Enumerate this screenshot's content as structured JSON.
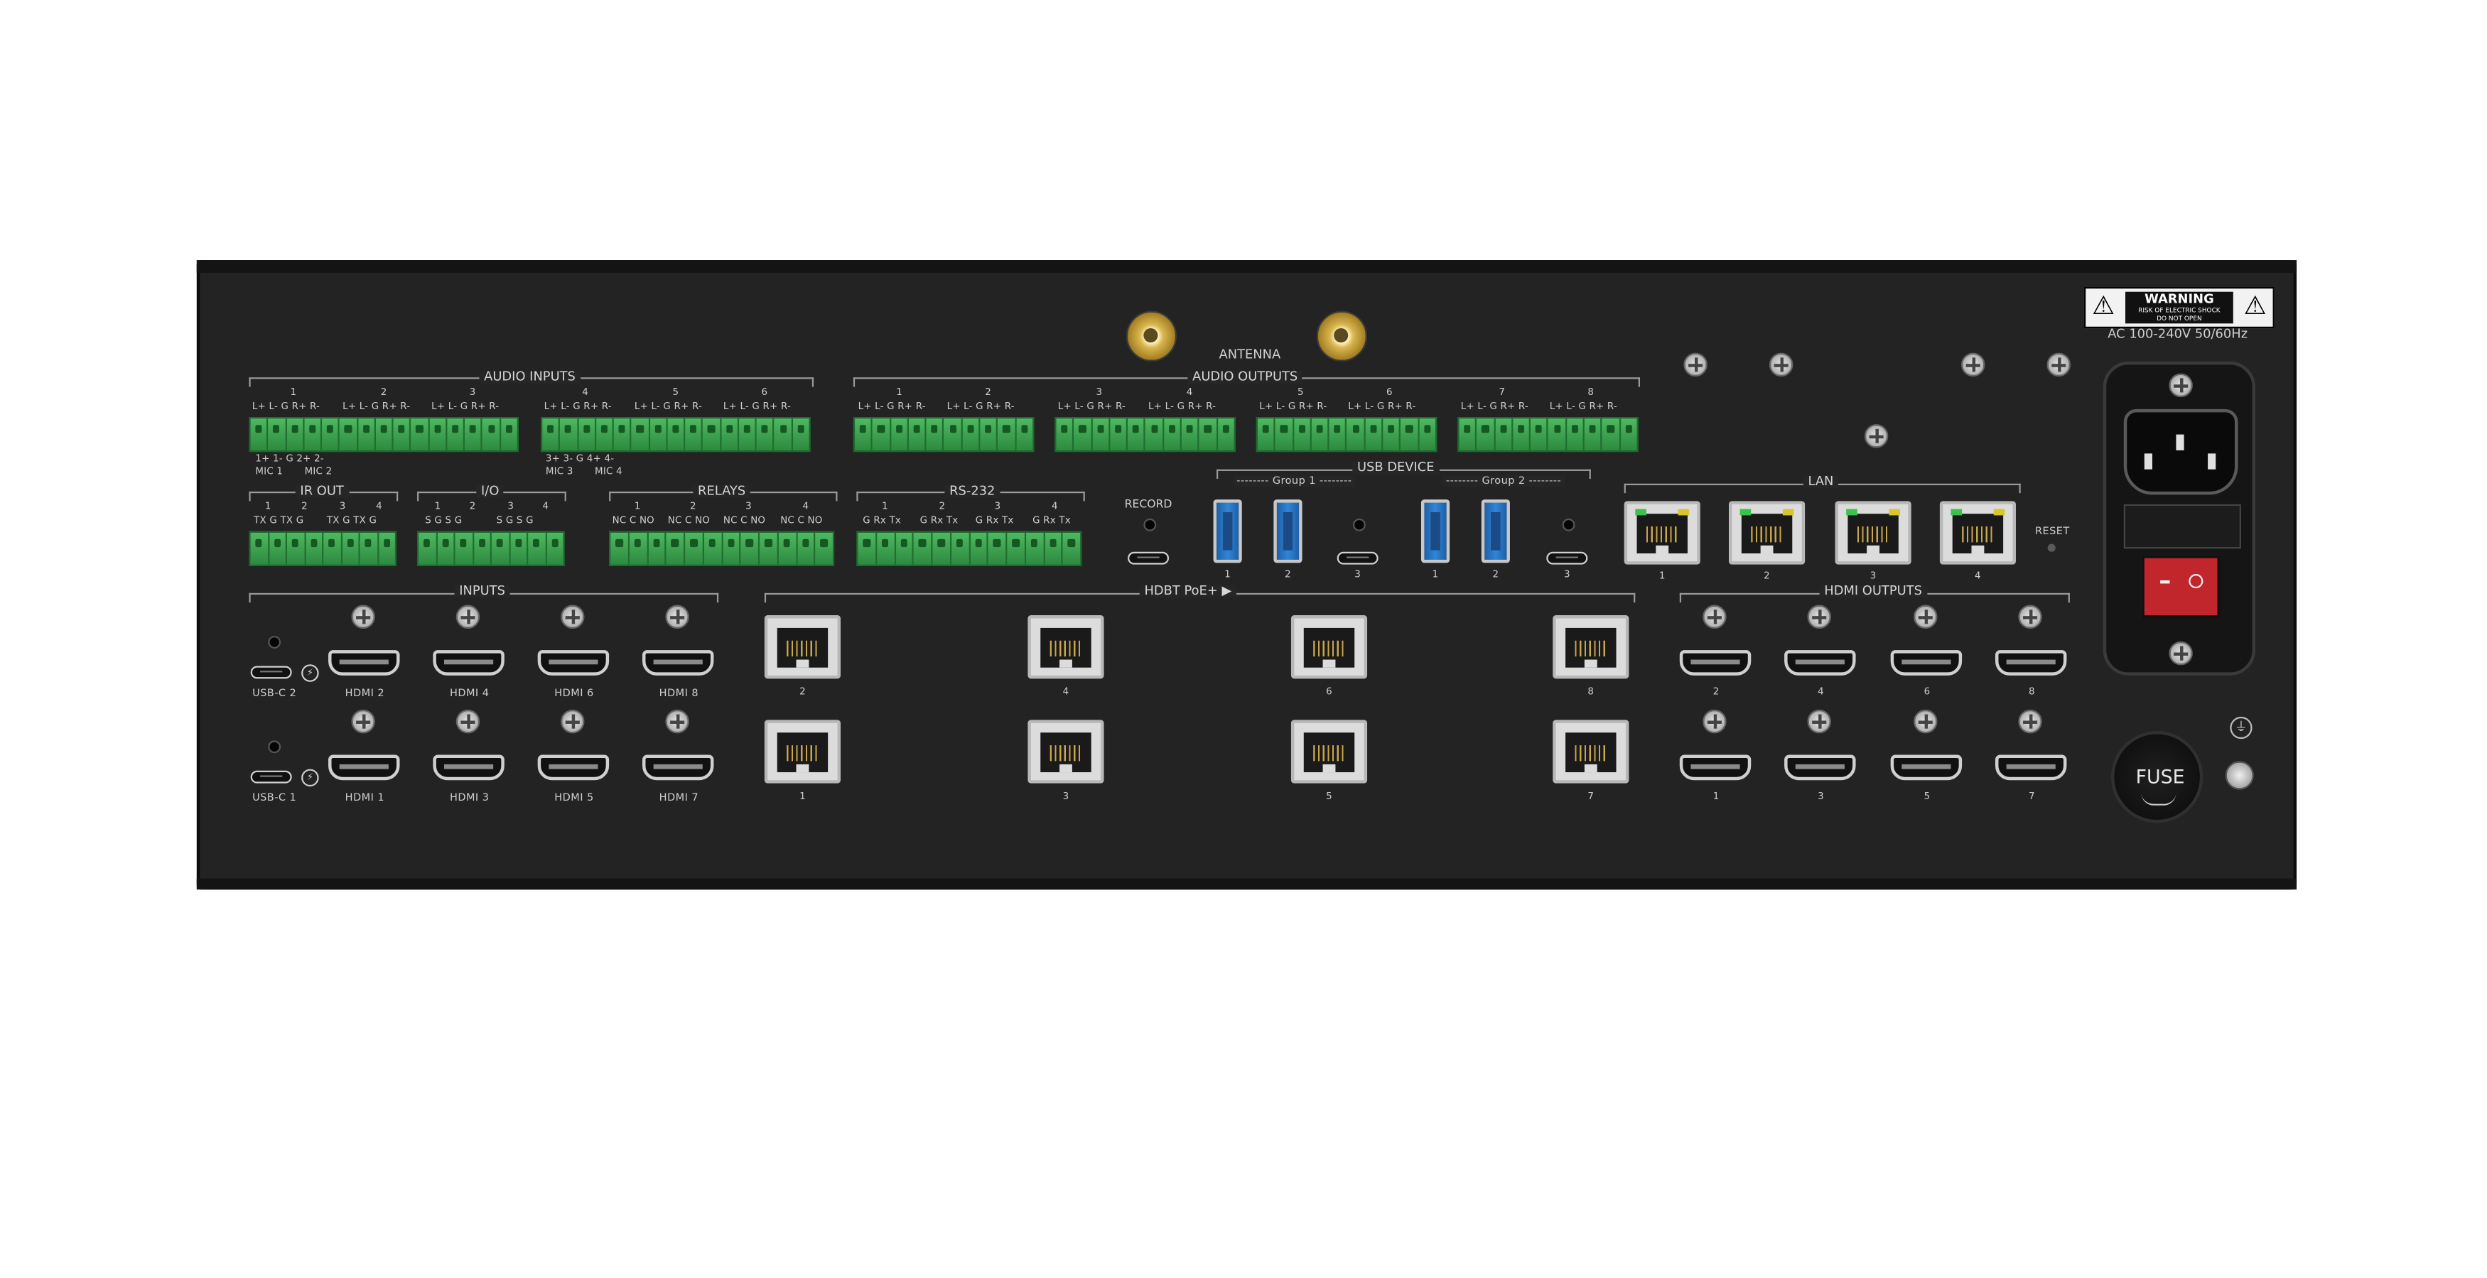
{
  "device": {
    "warning": {
      "title": "WARNING",
      "line1": "RISK OF ELECTRIC SHOCK",
      "line2": "DO NOT OPEN"
    },
    "power_rating": "AC 100-240V 50/60Hz",
    "antenna_label": "ANTENNA",
    "audio_inputs": {
      "title": "AUDIO INPUTS",
      "channels": [
        "1",
        "2",
        "3",
        "4",
        "5",
        "6"
      ],
      "pins": "L+ L- G R+ R-",
      "mic_labels": {
        "mic12_top": "1+ 1- G 2+ 2-",
        "mic1": "MIC 1",
        "mic2": "MIC 2",
        "mic34_top": "3+ 3- G 4+ 4-",
        "mic3": "MIC 3",
        "mic4": "MIC 4"
      }
    },
    "audio_outputs": {
      "title": "AUDIO OUTPUTS",
      "channels": [
        "1",
        "2",
        "3",
        "4",
        "5",
        "6",
        "7",
        "8"
      ],
      "pins": "L+ L- G R+ R-"
    },
    "ir_out": {
      "title": "IR OUT",
      "channels": [
        "1",
        "2",
        "3",
        "4"
      ],
      "pins": "TX G TX G"
    },
    "io": {
      "title": "I/O",
      "channels": [
        "1",
        "2",
        "3",
        "4"
      ],
      "pins": "S G S G"
    },
    "relays": {
      "title": "RELAYS",
      "channels": [
        "1",
        "2",
        "3",
        "4"
      ],
      "pins": "NC C NO"
    },
    "rs232": {
      "title": "RS-232",
      "channels": [
        "1",
        "2",
        "3",
        "4"
      ],
      "pins": "G Rx Tx"
    },
    "record_label": "RECORD",
    "usb_device": {
      "title": "USB DEVICE",
      "group1": "Group 1",
      "group2": "Group 2",
      "ports": [
        "1",
        "2",
        "3"
      ]
    },
    "lan": {
      "title": "LAN",
      "ports": [
        "1",
        "2",
        "3",
        "4"
      ],
      "reset": "RESET"
    },
    "inputs": {
      "title": "INPUTS",
      "top": [
        "USB-C 2",
        "HDMI 2",
        "HDMI 4",
        "HDMI 6",
        "HDMI 8"
      ],
      "bottom": [
        "USB-C 1",
        "HDMI 1",
        "HDMI 3",
        "HDMI 5",
        "HDMI 7"
      ]
    },
    "hdbt": {
      "title": "HDBT PoE+ ▶",
      "top": [
        "2",
        "4",
        "6",
        "8"
      ],
      "bottom": [
        "1",
        "3",
        "5",
        "7"
      ]
    },
    "hdmi_outputs": {
      "title": "HDMI OUTPUTS",
      "top": [
        "2",
        "4",
        "6",
        "8"
      ],
      "bottom": [
        "1",
        "3",
        "5",
        "7"
      ]
    },
    "fuse_label": "FUSE",
    "colors": {
      "chassis": "#262626",
      "terminal": "#3fa851",
      "usb_blue": "#2f86d6",
      "switch_red": "#c0262c"
    }
  }
}
